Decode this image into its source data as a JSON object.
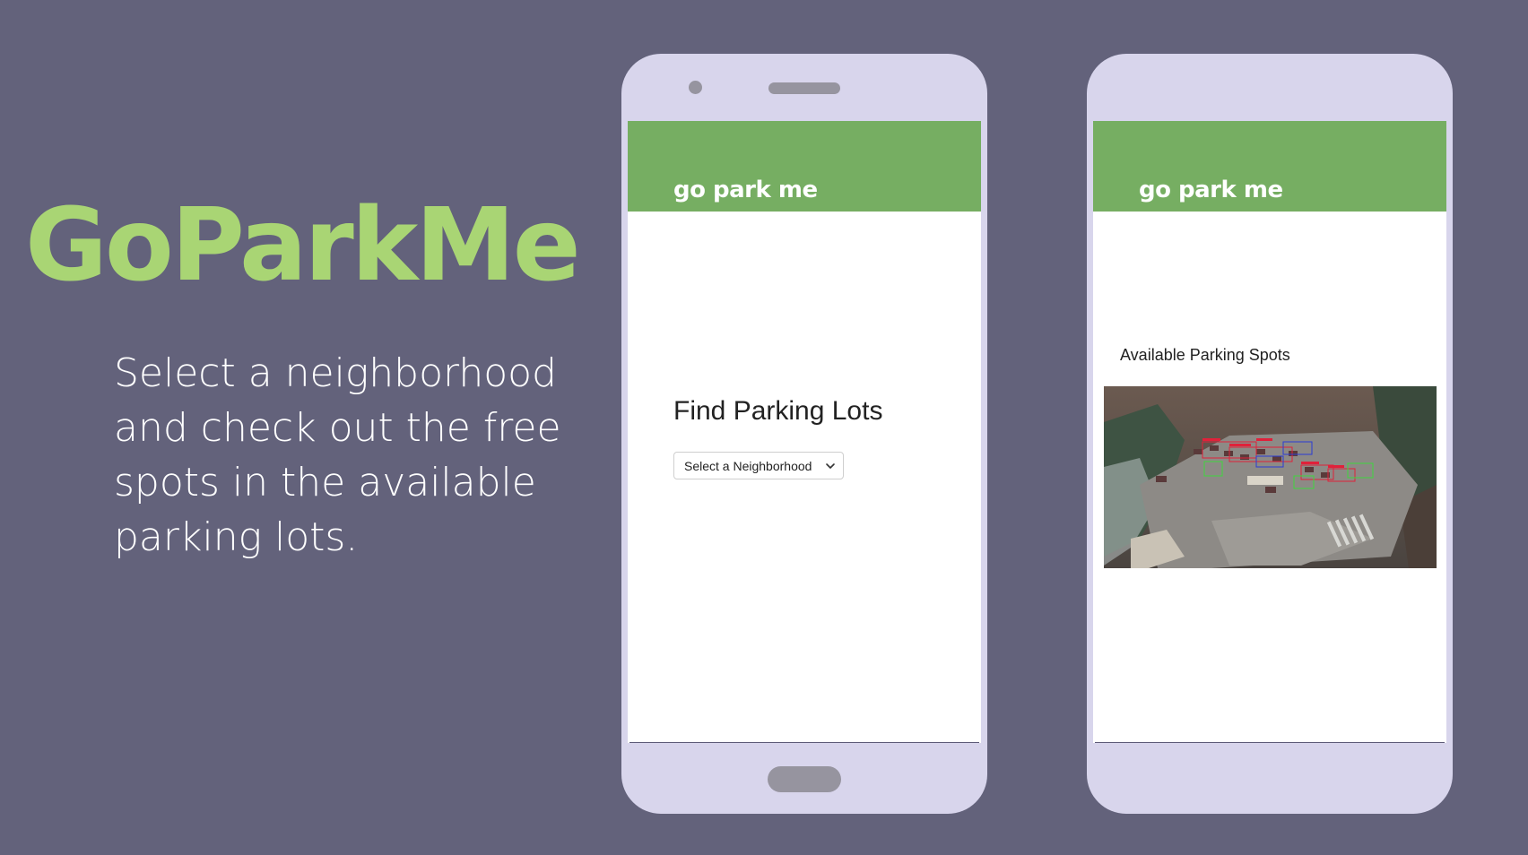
{
  "hero": {
    "title": "GoParkMe",
    "tagline": "Select a neighborhood and check out the free spots in the available parking lots."
  },
  "colors": {
    "background": "#63627b",
    "title_green": "#a9d574",
    "app_header_green": "#76ae62",
    "phone_body": "#d8d5ec"
  },
  "screens": {
    "find": {
      "app_name": "go park me",
      "heading": "Find Parking Lots",
      "select": {
        "selected_label": "Select a Neighborhood",
        "icon": "chevron-down-icon"
      }
    },
    "results": {
      "app_name": "go park me",
      "heading": "Available Parking Spots",
      "image": {
        "description": "aerial-parking-lot-detection-image"
      }
    }
  }
}
